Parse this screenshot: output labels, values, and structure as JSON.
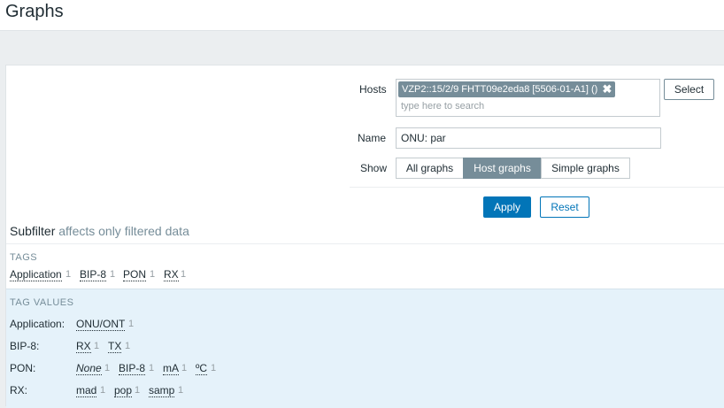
{
  "page": {
    "title": "Graphs"
  },
  "filter": {
    "hosts_label": "Hosts",
    "host_chip": "VZP2::15/2/9 FHTT09e2eda8 [5506-01-A1] ()",
    "chip_remove": "✖",
    "search_placeholder": "type here to search",
    "select_label": "Select",
    "name_label": "Name",
    "name_value": "ONU: par",
    "show_label": "Show",
    "show_options": [
      "All graphs",
      "Host graphs",
      "Simple graphs"
    ],
    "show_selected": "Host graphs",
    "apply_label": "Apply",
    "reset_label": "Reset"
  },
  "subfilter": {
    "title": "Subfilter",
    "note": "affects only filtered data",
    "tags_header": "TAGS",
    "tags": [
      {
        "name": "Application",
        "count": "1"
      },
      {
        "name": "BIP-8",
        "count": "1"
      },
      {
        "name": "PON",
        "count": "1"
      },
      {
        "name": "RX",
        "count": "1"
      }
    ],
    "tag_values_header": "TAG VALUES",
    "tag_values": [
      {
        "label": "Application:",
        "values": [
          {
            "name": "ONU/ONT",
            "count": "1"
          }
        ]
      },
      {
        "label": "BIP-8:",
        "values": [
          {
            "name": "RX",
            "count": "1"
          },
          {
            "name": "TX",
            "count": "1"
          }
        ]
      },
      {
        "label": "PON:",
        "values": [
          {
            "name": "None",
            "count": "1"
          },
          {
            "name": "BIP-8",
            "count": "1"
          },
          {
            "name": "mA",
            "count": "1"
          },
          {
            "name": "ºC",
            "count": "1"
          }
        ]
      },
      {
        "label": "RX:",
        "values": [
          {
            "name": "mad",
            "count": "1"
          },
          {
            "name": "pop",
            "count": "1"
          },
          {
            "name": "samp",
            "count": "1"
          }
        ]
      }
    ]
  }
}
